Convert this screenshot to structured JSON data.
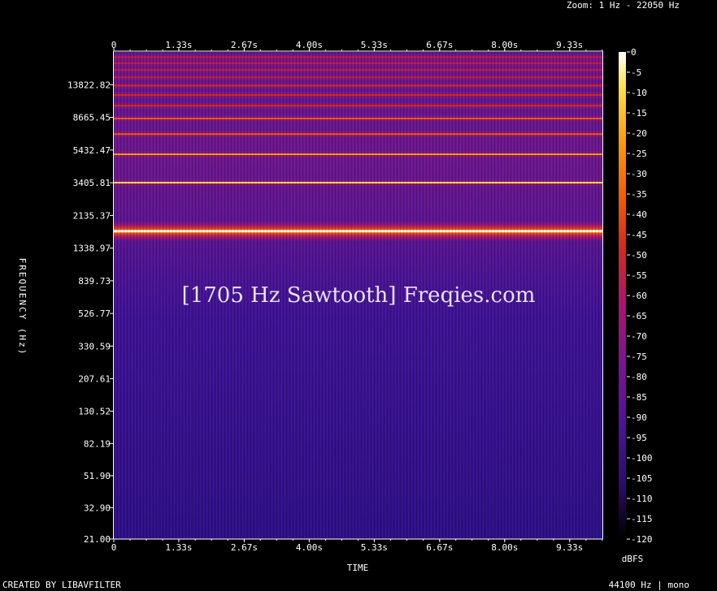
{
  "header": {
    "zoom_label": "Zoom: 1 Hz - 22050 Hz"
  },
  "footer": {
    "created_by": "CREATED BY LIBAVFILTER",
    "format": "44100 Hz | mono"
  },
  "watermark": {
    "text": "[1705 Hz Sawtooth] Freqies.com"
  },
  "colors": {
    "background": "#000000",
    "scale": [
      "#000000",
      "#0d0826",
      "#2a0f6e",
      "#4f1294",
      "#7a1490",
      "#a81470",
      "#d42a1e",
      "#f35a08",
      "#fb9d0a",
      "#fde24a",
      "#ffffff"
    ]
  },
  "chart_data": {
    "type": "heatmap",
    "title": "",
    "xlabel": "TIME",
    "ylabel": "FREQUENCY (Hz)",
    "x_ticks": [
      "0",
      "1.33s",
      "2.67s",
      "4.00s",
      "5.33s",
      "6.67s",
      "8.00s",
      "9.33s"
    ],
    "x_tick_values": [
      0,
      1.33,
      2.67,
      4.0,
      5.33,
      6.67,
      8.0,
      9.33
    ],
    "xlim": [
      0,
      10
    ],
    "y_scale": "log",
    "y_ticks": [
      "21.00",
      "32.90",
      "51.90",
      "82.19",
      "130.52",
      "207.61",
      "330.59",
      "526.77",
      "839.73",
      "1338.97",
      "2135.37",
      "3405.81",
      "5432.47",
      "8665.45",
      "13822.82"
    ],
    "y_tick_values": [
      21.0,
      32.9,
      51.9,
      82.19,
      130.52,
      207.61,
      330.59,
      526.77,
      839.73,
      1338.97,
      2135.37,
      3405.81,
      5432.47,
      8665.45,
      13822.82
    ],
    "ylim": [
      21,
      22050
    ],
    "fundamental_hz": 1705,
    "harmonics": [
      {
        "hz": 1705,
        "db": -3
      },
      {
        "hz": 3410,
        "db": -28
      },
      {
        "hz": 5115,
        "db": -38
      },
      {
        "hz": 6820,
        "db": -42
      },
      {
        "hz": 8525,
        "db": -45
      },
      {
        "hz": 10230,
        "db": -47
      },
      {
        "hz": 11935,
        "db": -49
      },
      {
        "hz": 13640,
        "db": -50
      },
      {
        "hz": 15345,
        "db": -52
      },
      {
        "hz": 17050,
        "db": -53
      },
      {
        "hz": 18755,
        "db": -54
      },
      {
        "hz": 20460,
        "db": -56
      }
    ],
    "colorbar": {
      "label": "dBFS",
      "ticks": [
        "0",
        "-5",
        "-10",
        "-15",
        "-20",
        "-25",
        "-30",
        "-35",
        "-40",
        "-45",
        "-50",
        "-55",
        "-60",
        "-65",
        "-70",
        "-75",
        "-80",
        "-85",
        "-90",
        "-95",
        "-100",
        "-105",
        "-110",
        "-115",
        "-120"
      ],
      "range": [
        -120,
        0
      ]
    }
  }
}
